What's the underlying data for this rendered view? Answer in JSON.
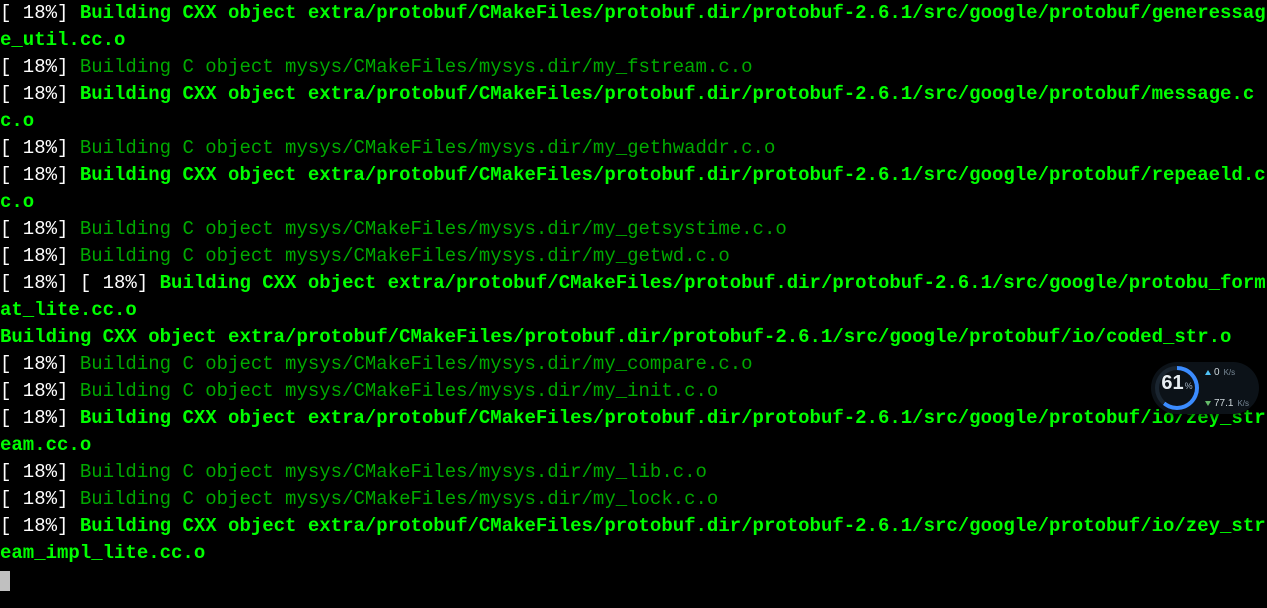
{
  "lines": [
    {
      "percent": "[ 18%]",
      "style": "bold",
      "text": "Building CXX object extra/protobuf/CMakeFiles/protobuf.dir/protobuf-2.6.1/src/google/protobuf/generessage_util.cc.o"
    },
    {
      "percent": "[ 18%]",
      "style": "norm",
      "text": "Building C object mysys/CMakeFiles/mysys.dir/my_fstream.c.o"
    },
    {
      "percent": "[ 18%]",
      "style": "bold",
      "text": "Building CXX object extra/protobuf/CMakeFiles/protobuf.dir/protobuf-2.6.1/src/google/protobuf/message.cc.o"
    },
    {
      "percent": "[ 18%]",
      "style": "norm",
      "text": "Building C object mysys/CMakeFiles/mysys.dir/my_gethwaddr.c.o"
    },
    {
      "percent": "[ 18%]",
      "style": "bold",
      "text": "Building CXX object extra/protobuf/CMakeFiles/protobuf.dir/protobuf-2.6.1/src/google/protobuf/repeaeld.cc.o"
    },
    {
      "percent": "[ 18%]",
      "style": "norm",
      "text": "Building C object mysys/CMakeFiles/mysys.dir/my_getsystime.c.o"
    },
    {
      "percent": "[ 18%]",
      "style": "norm",
      "text": "Building C object mysys/CMakeFiles/mysys.dir/my_getwd.c.o"
    },
    {
      "percent": "[ 18%] [ 18%]",
      "style": "bold",
      "text": "Building CXX object extra/protobuf/CMakeFiles/protobuf.dir/protobuf-2.6.1/src/google/protobu_format_lite.cc.o"
    },
    {
      "percent": "",
      "style": "bold",
      "text": "Building CXX object extra/protobuf/CMakeFiles/protobuf.dir/protobuf-2.6.1/src/google/protobuf/io/coded_str.o"
    },
    {
      "percent": "[ 18%]",
      "style": "norm",
      "text": "Building C object mysys/CMakeFiles/mysys.dir/my_compare.c.o"
    },
    {
      "percent": "[ 18%]",
      "style": "norm",
      "text": "Building C object mysys/CMakeFiles/mysys.dir/my_init.c.o"
    },
    {
      "percent": "[ 18%]",
      "style": "bold",
      "text": "Building CXX object extra/protobuf/CMakeFiles/protobuf.dir/protobuf-2.6.1/src/google/protobuf/io/zey_stream.cc.o"
    },
    {
      "percent": "[ 18%]",
      "style": "norm",
      "text": "Building C object mysys/CMakeFiles/mysys.dir/my_lib.c.o"
    },
    {
      "percent": "[ 18%]",
      "style": "norm",
      "text": "Building C object mysys/CMakeFiles/mysys.dir/my_lock.c.o"
    },
    {
      "percent": "[ 18%]",
      "style": "bold",
      "text": "Building CXX object extra/protobuf/CMakeFiles/protobuf.dir/protobuf-2.6.1/src/google/protobuf/io/zey_stream_impl_lite.cc.o"
    }
  ],
  "widget": {
    "percent": "61",
    "percent_unit": "%",
    "upload": "0",
    "upload_unit": "K/s",
    "download": "77.1",
    "download_unit": "K/s"
  }
}
